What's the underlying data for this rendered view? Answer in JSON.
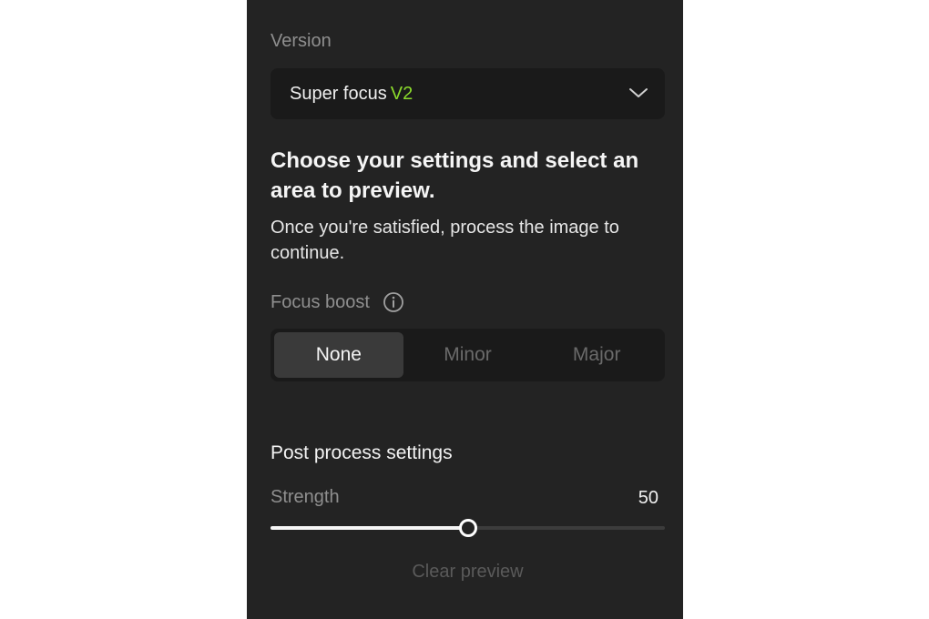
{
  "version": {
    "label": "Version",
    "selected_text": "Super focus",
    "selected_accent": "V2",
    "accent_color": "#8bdb2c",
    "icon": "chevron-down-icon"
  },
  "heading": "Choose your settings and select an area to preview.",
  "description": "Once you're satisfied, process the image to continue.",
  "focus_boost": {
    "label": "Focus boost",
    "info_icon": "info-icon",
    "options": [
      "None",
      "Minor",
      "Major"
    ],
    "selected": "None"
  },
  "post_process": {
    "title": "Post process settings",
    "strength_label": "Strength",
    "strength_value": "50",
    "strength_fraction": 0.5
  },
  "clear_preview_label": "Clear preview"
}
